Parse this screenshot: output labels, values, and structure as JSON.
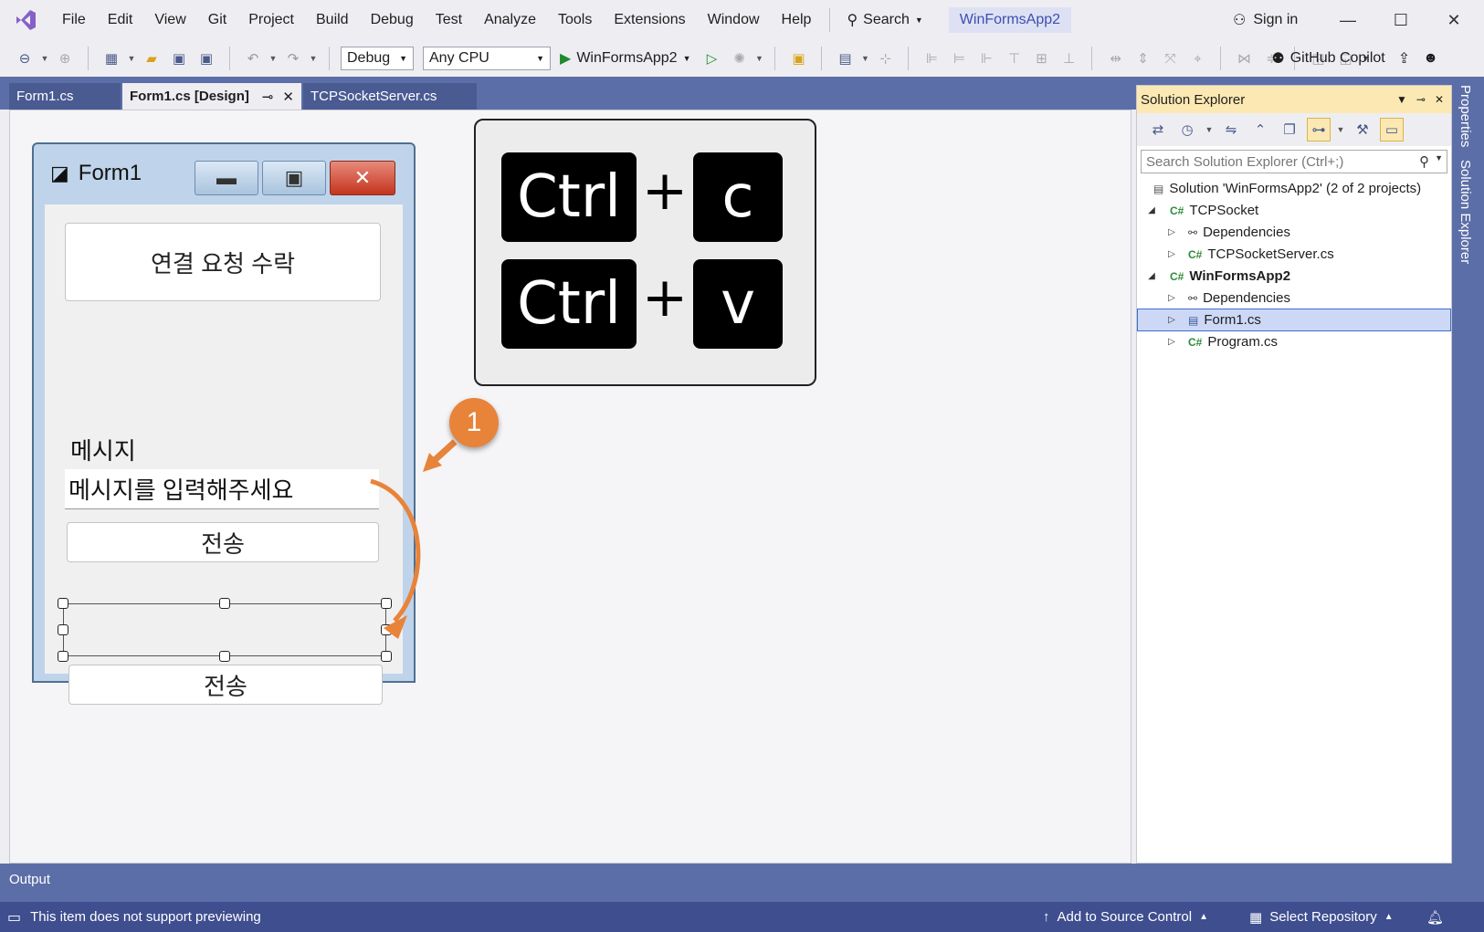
{
  "menu": {
    "items": [
      "File",
      "Edit",
      "View",
      "Git",
      "Project",
      "Build",
      "Debug",
      "Test",
      "Analyze",
      "Tools",
      "Extensions",
      "Window",
      "Help"
    ],
    "search_label": "Search",
    "solution_name": "WinFormsApp2",
    "sign_in": "Sign in"
  },
  "toolbar": {
    "configuration": "Debug",
    "platform": "Any CPU",
    "run_target": "WinFormsApp2",
    "copilot": "GitHub Copilot"
  },
  "tabs": [
    {
      "label": "Form1.cs"
    },
    {
      "label": "Form1.cs [Design]"
    },
    {
      "label": "TCPSocketServer.cs"
    }
  ],
  "form": {
    "title": "Form1",
    "accept_button": "연결 요청 수락",
    "message_label": "메시지",
    "message_input": "메시지를 입력해주세요",
    "send_button": "전송",
    "send_button_copy": "전송"
  },
  "shortcut": {
    "row1": {
      "mod": "Ctrl",
      "plus": "+",
      "key": "c"
    },
    "row2": {
      "mod": "Ctrl",
      "plus": "+",
      "key": "v"
    }
  },
  "step_badge": "1",
  "solution_explorer": {
    "title": "Solution Explorer",
    "search_placeholder": "Search Solution Explorer (Ctrl+;)",
    "tree": [
      {
        "label": "Solution 'WinFormsApp2' (2 of 2 projects)",
        "icon": "solution-icon",
        "bold": false
      },
      {
        "label": "TCPSocket",
        "icon": "csproj-icon",
        "bold": false
      },
      {
        "label": "Dependencies",
        "icon": "dependencies-icon",
        "bold": false
      },
      {
        "label": "TCPSocketServer.cs",
        "icon": "csharp-file-icon",
        "bold": false
      },
      {
        "label": "WinFormsApp2",
        "icon": "csproj-icon",
        "bold": true
      },
      {
        "label": "Dependencies",
        "icon": "dependencies-icon",
        "bold": false
      },
      {
        "label": "Form1.cs",
        "icon": "form-file-icon",
        "bold": false,
        "selected": true
      },
      {
        "label": "Program.cs",
        "icon": "csharp-file-icon",
        "bold": false
      }
    ]
  },
  "side_tabs": [
    "Properties",
    "Solution Explorer"
  ],
  "output": {
    "label": "Output"
  },
  "status": {
    "message": "This item does not support previewing",
    "source_control": "Add to Source Control",
    "repository": "Select Repository"
  },
  "colors": {
    "accent_orange": "#e8833a",
    "vs_blue": "#5c6ea7",
    "status_blue": "#3e4e8f",
    "selection": "#ccd8f5"
  }
}
